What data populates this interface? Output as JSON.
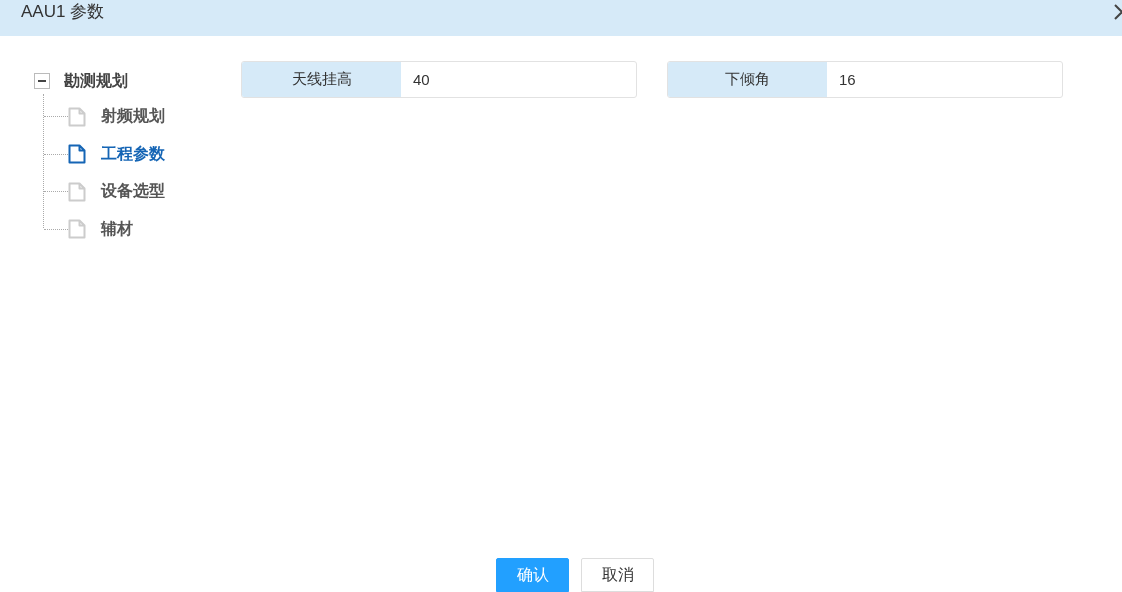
{
  "window": {
    "title": "AAU1 参数"
  },
  "tree": [
    {
      "label": "勘测规划",
      "expanded": true,
      "children": [
        {
          "label": "射频规划",
          "selected": false
        },
        {
          "label": "工程参数",
          "selected": true
        },
        {
          "label": "设备选型",
          "selected": false
        },
        {
          "label": "辅材",
          "selected": false
        }
      ]
    }
  ],
  "fields": [
    {
      "label": "天线挂高",
      "value": "40"
    },
    {
      "label": "下倾角",
      "value": "16"
    }
  ],
  "buttons": [
    {
      "label": "确认",
      "kind": "primary"
    },
    {
      "label": "取消",
      "kind": "default"
    }
  ]
}
